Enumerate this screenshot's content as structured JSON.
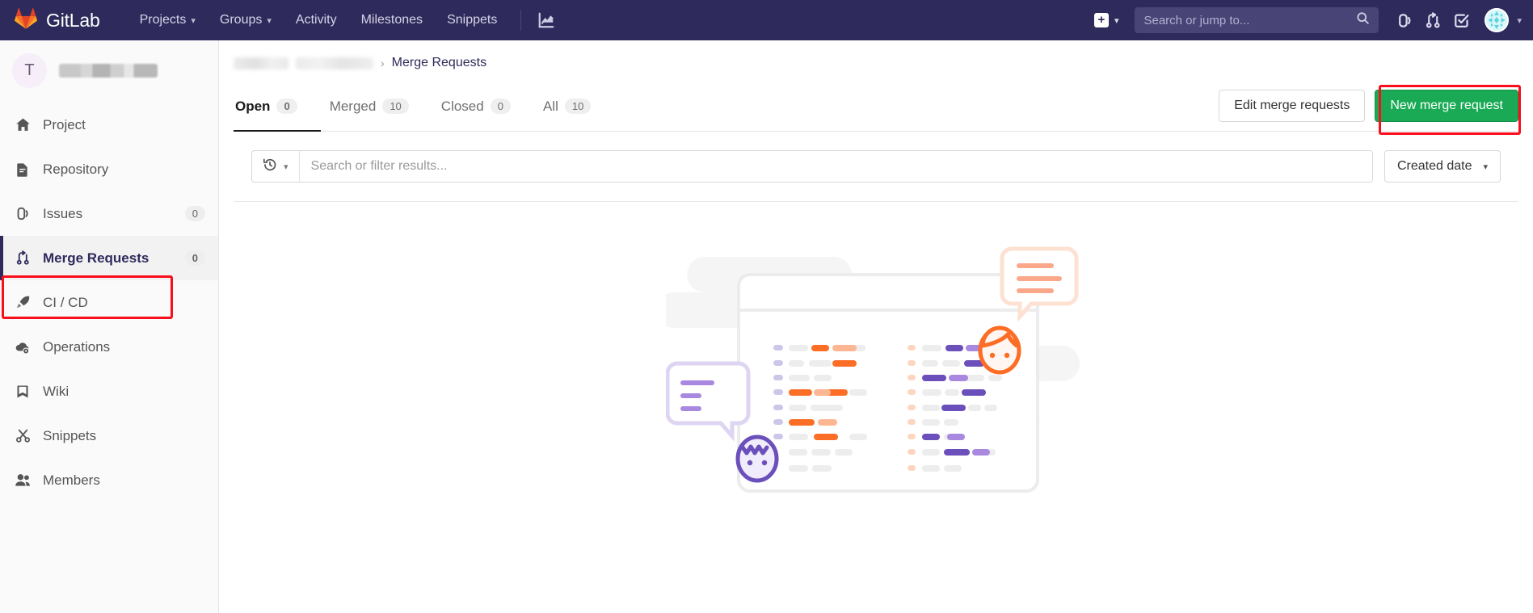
{
  "navbar": {
    "brand": "GitLab",
    "brand_icon": "gitlab-logo-icon",
    "links": [
      {
        "label": "Projects",
        "icon": "chevron-down-icon",
        "has_caret": true
      },
      {
        "label": "Groups",
        "icon": "chevron-down-icon",
        "has_caret": true
      },
      {
        "label": "Activity",
        "has_caret": false
      },
      {
        "label": "Milestones",
        "has_caret": false
      },
      {
        "label": "Snippets",
        "has_caret": false
      }
    ],
    "analytics_icon": "chart-icon",
    "new_label": "+",
    "search": {
      "value": "",
      "placeholder": "Search or jump to...",
      "icon": "search-icon"
    },
    "icons": [
      {
        "name": "issues-icon"
      },
      {
        "name": "merge-request-icon"
      },
      {
        "name": "todos-done-icon"
      }
    ],
    "avatar_icon": "user-avatar-identicon",
    "caret": "⌄"
  },
  "sidebar": {
    "project_initial": "T",
    "project_name_redacted": true,
    "items": [
      {
        "label": "Project",
        "icon": "home-icon",
        "count": "",
        "active": false
      },
      {
        "label": "Repository",
        "icon": "document-icon",
        "count": "",
        "active": false
      },
      {
        "label": "Issues",
        "icon": "issues-icon",
        "count": "0",
        "active": false
      },
      {
        "label": "Merge Requests",
        "icon": "merge-request-icon",
        "count": "0",
        "active": true
      },
      {
        "label": "CI / CD",
        "icon": "rocket-icon",
        "count": "",
        "active": false
      },
      {
        "label": "Operations",
        "icon": "cloud-gear-icon",
        "count": "",
        "active": false
      },
      {
        "label": "Wiki",
        "icon": "book-icon",
        "count": "",
        "active": false
      },
      {
        "label": "Snippets",
        "icon": "scissors-icon",
        "count": "",
        "active": false
      },
      {
        "label": "Members",
        "icon": "users-icon",
        "count": "",
        "active": false
      }
    ]
  },
  "breadcrumb": {
    "group_redacted": "",
    "project_redacted": "",
    "separator": "›",
    "current": "Merge Requests"
  },
  "tabs": [
    {
      "label": "Open",
      "count": "0",
      "active": true
    },
    {
      "label": "Merged",
      "count": "10",
      "active": false
    },
    {
      "label": "Closed",
      "count": "0",
      "active": false
    },
    {
      "label": "All",
      "count": "10",
      "active": false
    }
  ],
  "actions": {
    "edit_label": "Edit merge requests",
    "new_label": "New merge request"
  },
  "filter": {
    "recent_icon": "history-icon",
    "recent_caret": "⌄",
    "value": "",
    "placeholder": "Search or filter results...",
    "sort_label": "Created date",
    "sort_caret": "⌄"
  },
  "empty_state": {
    "illustration": "merge-requests-empty-illustration"
  },
  "colors": {
    "navbar_bg": "#2e2a5b",
    "brand_orange": "#fc6d26",
    "success_green": "#1aaa55",
    "highlight_red": "#fc0d1b",
    "sidebar_bg": "#fafafa",
    "illus_orange": "#fc6d26",
    "illus_purple": "#6b4fbb"
  }
}
